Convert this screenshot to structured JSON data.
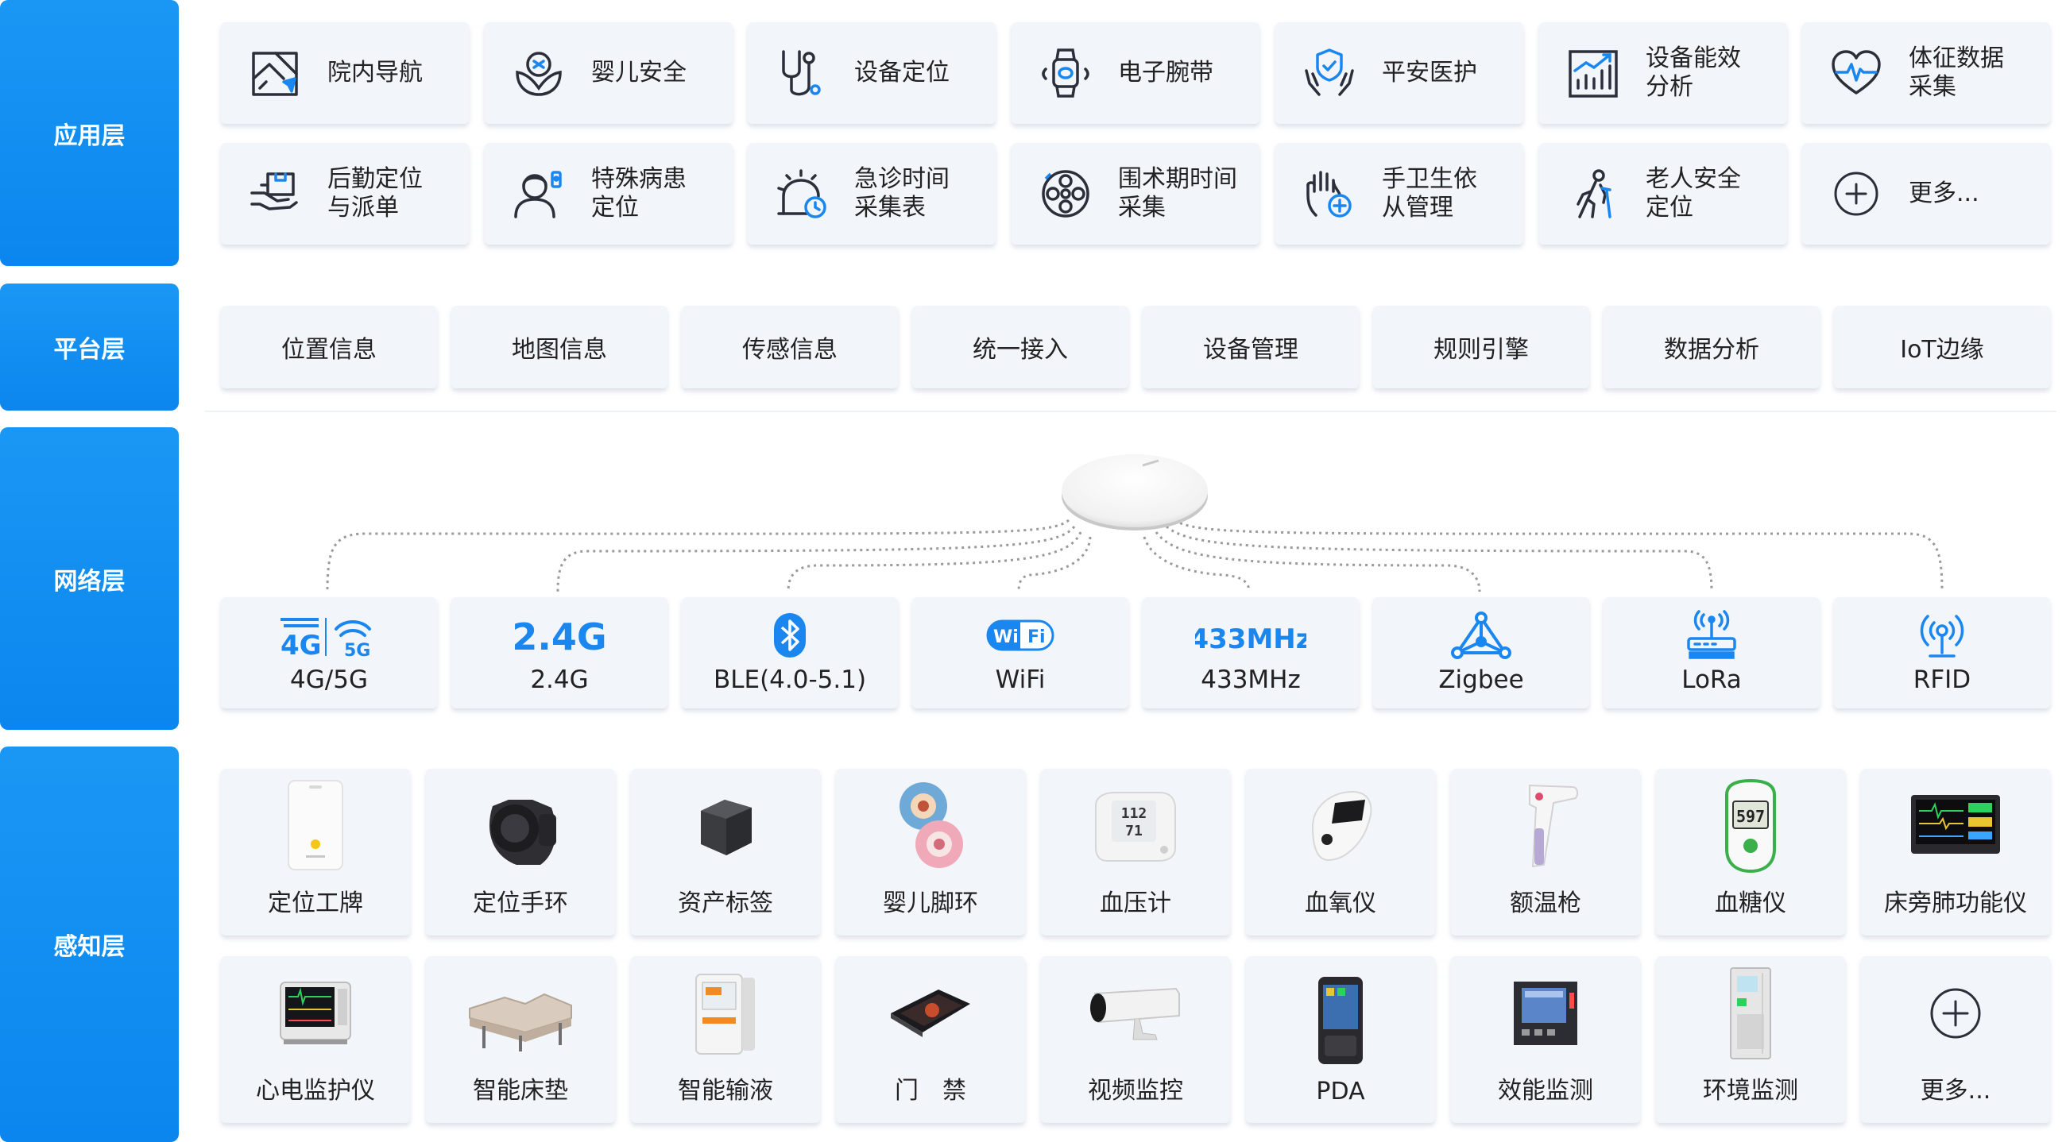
{
  "layers": {
    "app": "应用层",
    "platform": "平台层",
    "network": "网络层",
    "sensing": "感知层"
  },
  "apps": [
    {
      "label": "院内导航",
      "icon": "navigation-map-icon"
    },
    {
      "label": "婴儿安全",
      "icon": "baby-safety-icon"
    },
    {
      "label": "设备定位",
      "icon": "stethoscope-locate-icon"
    },
    {
      "label": "电子腕带",
      "icon": "wristband-icon"
    },
    {
      "label": "平安医护",
      "icon": "shield-hands-icon"
    },
    {
      "label": "设备能效\n分析",
      "icon": "efficiency-chart-icon"
    },
    {
      "label": "体征数据\n采集",
      "icon": "heart-pulse-icon"
    },
    {
      "label": "后勤定位\n与派单",
      "icon": "logistics-dispatch-icon"
    },
    {
      "label": "特殊病患\n定位",
      "icon": "patient-tag-icon"
    },
    {
      "label": "急诊时间\n采集表",
      "icon": "alarm-clock-icon"
    },
    {
      "label": "围术期时间\n采集",
      "icon": "film-reel-icon"
    },
    {
      "label": "手卫生依\n从管理",
      "icon": "hand-hygiene-icon"
    },
    {
      "label": "老人安全\n定位",
      "icon": "elderly-icon"
    },
    {
      "label": "更多...",
      "icon": "plus-circle-icon"
    }
  ],
  "platform": [
    "位置信息",
    "地图信息",
    "传感信息",
    "统一接入",
    "设备管理",
    "规则引擎",
    "数据分析",
    "IoT边缘"
  ],
  "network": [
    {
      "label": "4G/5G",
      "icon": "cellular-icon",
      "icon_text": [
        "4G",
        "5G"
      ]
    },
    {
      "label": "2.4G",
      "icon": "text-2-4g-icon",
      "icon_text": [
        "2.4G"
      ]
    },
    {
      "label": "BLE(4.0-5.1)",
      "icon": "bluetooth-icon",
      "icon_text": []
    },
    {
      "label": "WiFi",
      "icon": "wifi-badge-icon",
      "icon_text": [
        "Wi",
        "Fi"
      ]
    },
    {
      "label": "433MHz",
      "icon": "text-433mhz-icon",
      "icon_text": [
        "433MHz"
      ]
    },
    {
      "label": "Zigbee",
      "icon": "zigbee-triangle-icon",
      "icon_text": []
    },
    {
      "label": "LoRa",
      "icon": "lora-router-icon",
      "icon_text": []
    },
    {
      "label": "RFID",
      "icon": "rfid-antenna-icon",
      "icon_text": []
    }
  ],
  "gateway": {
    "icon": "gateway-disc-icon"
  },
  "devices": [
    {
      "label": "定位工牌",
      "icon": "badge-device-icon"
    },
    {
      "label": "定位手环",
      "icon": "wrist-band-device-icon"
    },
    {
      "label": "资产标签",
      "icon": "asset-tag-cube-icon"
    },
    {
      "label": "婴儿脚环",
      "icon": "baby-anklet-icon"
    },
    {
      "label": "血压计",
      "icon": "blood-pressure-monitor-icon",
      "readout": [
        "112",
        "71"
      ]
    },
    {
      "label": "血氧仪",
      "icon": "pulse-oximeter-icon"
    },
    {
      "label": "额温枪",
      "icon": "thermometer-gun-icon"
    },
    {
      "label": "血糖仪",
      "icon": "glucose-meter-icon",
      "readout": [
        "597"
      ]
    },
    {
      "label": "床旁肺功能仪",
      "icon": "bedside-monitor-icon"
    },
    {
      "label": "心电监护仪",
      "icon": "ecg-monitor-icon"
    },
    {
      "label": "智能床垫",
      "icon": "smart-mattress-icon"
    },
    {
      "label": "智能输液",
      "icon": "infusion-pump-icon"
    },
    {
      "label": "门　禁",
      "icon": "access-control-icon"
    },
    {
      "label": "视频监控",
      "icon": "cctv-camera-icon"
    },
    {
      "label": "PDA",
      "icon": "pda-device-icon"
    },
    {
      "label": "效能监测",
      "icon": "energy-meter-icon"
    },
    {
      "label": "环境监测",
      "icon": "environment-cabinet-icon"
    },
    {
      "label": "更多...",
      "icon": "plus-circle-icon"
    }
  ],
  "colors": {
    "accent": "#1a97f5",
    "card": "#f2f6fb",
    "icon": "#2a2f3a",
    "net_icon": "#1a86f0",
    "dot": "#9a9a9a"
  }
}
